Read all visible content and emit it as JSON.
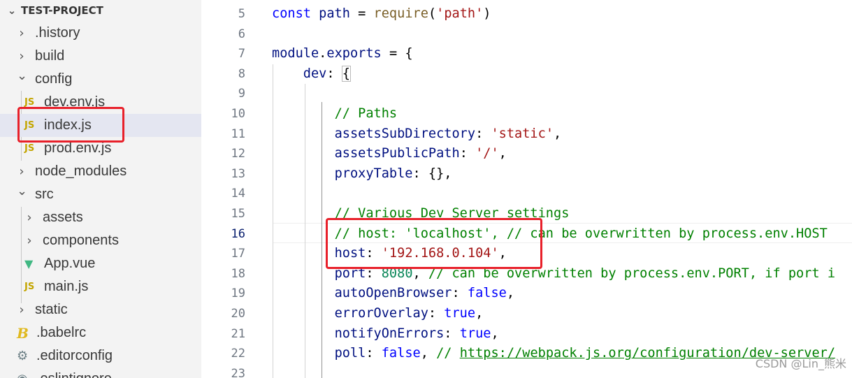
{
  "explorer": {
    "project_title": "TEST-PROJECT",
    "items": [
      {
        "label": ".history",
        "type": "folder",
        "state": "collapsed",
        "icon": "chevron-right-icon"
      },
      {
        "label": "build",
        "type": "folder",
        "state": "collapsed",
        "icon": "chevron-right-icon"
      },
      {
        "label": "config",
        "type": "folder",
        "state": "expanded",
        "icon": "chevron-down-icon"
      },
      {
        "label": "dev.env.js",
        "type": "file",
        "icon": "js-file-icon",
        "icon_text": "JS"
      },
      {
        "label": "index.js",
        "type": "file",
        "icon": "js-file-icon",
        "icon_text": "JS",
        "selected": true
      },
      {
        "label": "prod.env.js",
        "type": "file",
        "icon": "js-file-icon",
        "icon_text": "JS"
      },
      {
        "label": "node_modules",
        "type": "folder",
        "state": "collapsed",
        "icon": "chevron-right-icon"
      },
      {
        "label": "src",
        "type": "folder",
        "state": "expanded",
        "icon": "chevron-down-icon"
      },
      {
        "label": "assets",
        "type": "folder",
        "state": "collapsed",
        "icon": "chevron-right-icon"
      },
      {
        "label": "components",
        "type": "folder",
        "state": "collapsed",
        "icon": "chevron-right-icon"
      },
      {
        "label": "App.vue",
        "type": "file",
        "icon": "vue-file-icon"
      },
      {
        "label": "main.js",
        "type": "file",
        "icon": "js-file-icon",
        "icon_text": "JS"
      },
      {
        "label": "static",
        "type": "folder",
        "state": "collapsed",
        "icon": "chevron-right-icon"
      },
      {
        "label": ".babelrc",
        "type": "file",
        "icon": "babel-file-icon"
      },
      {
        "label": ".editorconfig",
        "type": "file",
        "icon": "gear-icon"
      },
      {
        "label": ".eslintignore",
        "type": "file",
        "icon": "eslint-file-icon"
      }
    ]
  },
  "editor": {
    "active_line": "16",
    "lines": [
      {
        "n": "5",
        "tokens": [
          [
            "kw",
            "const "
          ],
          [
            "prop",
            "path"
          ],
          [
            "punc",
            " = "
          ],
          [
            "fn",
            "require"
          ],
          [
            "punc",
            "("
          ],
          [
            "str",
            "'path'"
          ],
          [
            "punc",
            ")"
          ]
        ]
      },
      {
        "n": "6",
        "tokens": []
      },
      {
        "n": "7",
        "tokens": [
          [
            "prop",
            "module"
          ],
          [
            "punc",
            "."
          ],
          [
            "prop",
            "exports"
          ],
          [
            "punc",
            " = {"
          ]
        ]
      },
      {
        "n": "8",
        "tokens": [
          [
            "punc",
            "    "
          ],
          [
            "prop",
            "dev"
          ],
          [
            "punc",
            ": "
          ],
          [
            "punc",
            "{"
          ]
        ]
      },
      {
        "n": "9",
        "tokens": []
      },
      {
        "n": "10",
        "tokens": [
          [
            "punc",
            "        "
          ],
          [
            "cmt",
            "// Paths"
          ]
        ]
      },
      {
        "n": "11",
        "tokens": [
          [
            "punc",
            "        "
          ],
          [
            "prop",
            "assetsSubDirectory"
          ],
          [
            "punc",
            ": "
          ],
          [
            "str",
            "'static'"
          ],
          [
            "punc",
            ","
          ]
        ]
      },
      {
        "n": "12",
        "tokens": [
          [
            "punc",
            "        "
          ],
          [
            "prop",
            "assetsPublicPath"
          ],
          [
            "punc",
            ": "
          ],
          [
            "str",
            "'/'"
          ],
          [
            "punc",
            ","
          ]
        ]
      },
      {
        "n": "13",
        "tokens": [
          [
            "punc",
            "        "
          ],
          [
            "prop",
            "proxyTable"
          ],
          [
            "punc",
            ": {},"
          ]
        ]
      },
      {
        "n": "14",
        "tokens": []
      },
      {
        "n": "15",
        "tokens": [
          [
            "punc",
            "        "
          ],
          [
            "cmt",
            "// Various Dev Server settings"
          ]
        ]
      },
      {
        "n": "16",
        "tokens": [
          [
            "punc",
            "        "
          ],
          [
            "cmt",
            "// host: 'localhost', // can be overwritten by process.env.HOST"
          ]
        ]
      },
      {
        "n": "17",
        "tokens": [
          [
            "punc",
            "        "
          ],
          [
            "prop",
            "host"
          ],
          [
            "punc",
            ": "
          ],
          [
            "str",
            "'192.168.0.104'"
          ],
          [
            "punc",
            ","
          ]
        ]
      },
      {
        "n": "18",
        "tokens": [
          [
            "punc",
            "        "
          ],
          [
            "prop",
            "port"
          ],
          [
            "punc",
            ": "
          ],
          [
            "num",
            "8080"
          ],
          [
            "punc",
            ", "
          ],
          [
            "cmt",
            "// can be overwritten by process.env.PORT, if port i"
          ]
        ]
      },
      {
        "n": "19",
        "tokens": [
          [
            "punc",
            "        "
          ],
          [
            "prop",
            "autoOpenBrowser"
          ],
          [
            "punc",
            ": "
          ],
          [
            "kw",
            "false"
          ],
          [
            "punc",
            ","
          ]
        ]
      },
      {
        "n": "20",
        "tokens": [
          [
            "punc",
            "        "
          ],
          [
            "prop",
            "errorOverlay"
          ],
          [
            "punc",
            ": "
          ],
          [
            "kw",
            "true"
          ],
          [
            "punc",
            ","
          ]
        ]
      },
      {
        "n": "21",
        "tokens": [
          [
            "punc",
            "        "
          ],
          [
            "prop",
            "notifyOnErrors"
          ],
          [
            "punc",
            ": "
          ],
          [
            "kw",
            "true"
          ],
          [
            "punc",
            ","
          ]
        ]
      },
      {
        "n": "22",
        "tokens": [
          [
            "punc",
            "        "
          ],
          [
            "prop",
            "poll"
          ],
          [
            "punc",
            ": "
          ],
          [
            "kw",
            "false"
          ],
          [
            "punc",
            ", "
          ],
          [
            "cmt",
            "// "
          ],
          [
            "link",
            "https://webpack.js.org/configuration/dev-server/"
          ]
        ]
      },
      {
        "n": "23",
        "tokens": []
      }
    ]
  },
  "watermark": "CSDN @Lin_熊米",
  "colors": {
    "highlight_box": "#e8202a",
    "sidebar_bg": "#f3f3f3",
    "selected_row": "#e4e6f1"
  }
}
